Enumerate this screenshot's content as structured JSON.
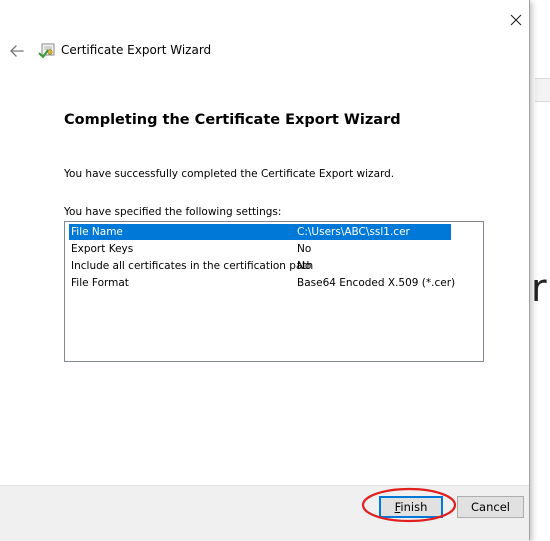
{
  "dialog": {
    "title": "Certificate Export Wizard",
    "heading": "Completing the Certificate Export Wizard",
    "success_message": "You have successfully completed the Certificate Export wizard.",
    "settings_label": "You have specified the following settings:"
  },
  "settings": [
    {
      "key": "File Name",
      "value": "C:\\Users\\ABC\\ssl1.cer",
      "selected": true
    },
    {
      "key": "Export Keys",
      "value": "No"
    },
    {
      "key": "Include all certificates in the certification path",
      "value": "No"
    },
    {
      "key": "File Format",
      "value": "Base64 Encoded X.509 (*.cer)"
    }
  ],
  "buttons": {
    "finish_label": "Finish",
    "cancel_label": "Cancel"
  },
  "background": {
    "partial_letter": "r"
  },
  "colors": {
    "selection": "#0078d7",
    "annotation": "#e0201e",
    "footer": "#f0f0f0"
  },
  "icons": [
    "back-arrow-icon",
    "certificate-wizard-icon",
    "close-icon"
  ]
}
